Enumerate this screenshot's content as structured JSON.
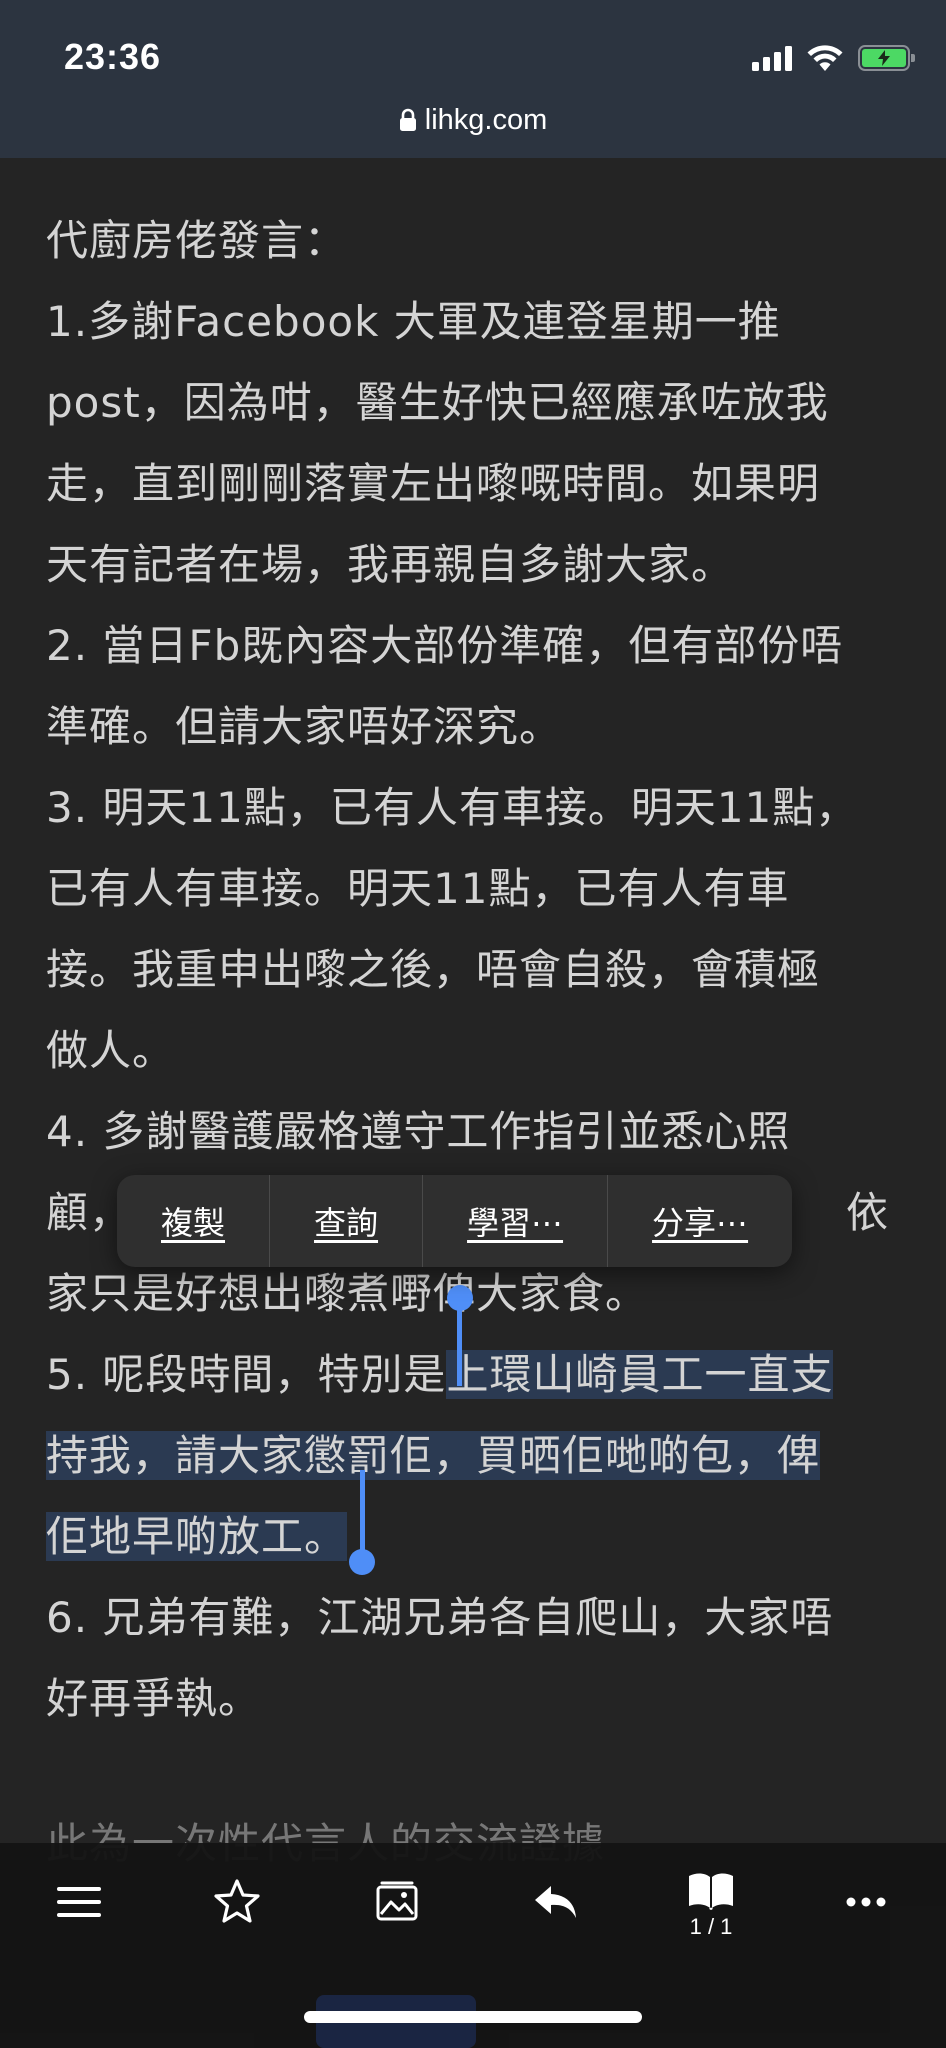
{
  "status_bar": {
    "time": "23:36"
  },
  "browser": {
    "url": "lihkg.com"
  },
  "article": {
    "lines": [
      "代廚房佬發言：",
      "1.多謝Facebook 大軍及連登星期一推",
      "post，因為咁，醫生好快已經應承咗放我",
      "走，直到剛剛落實左出嚟嘅時間。如果明",
      "天有記者在場，我再親自多謝大家。",
      "2. 當日Fb既內容大部份準確，但有部份唔",
      "準確。但請大家唔好深究。",
      "3. 明天11點，已有人有車接。明天11點，",
      "已有人有車接。明天11點，已有人有車",
      "接。我重申出嚟之後，唔會自殺，會積極",
      "做人。",
      "4. 多謝醫護嚴格遵守工作指引並悉心照",
      "顧，",
      "家只是好想出嚟煮嘢俾大家食。",
      "5. 呢段時間，特別是",
      "上環山崎員工一直支",
      "持我，請大家懲罰佢，買晒佢哋啲包，俾",
      "佢地早啲放工。",
      "6. 兄弟有難，江湖兄弟各自爬山，大家唔",
      "好再爭執。"
    ],
    "line13_tail": "依",
    "cutoff_line": "此為一次性代言人的交流證據"
  },
  "context_menu": {
    "copy": "複製",
    "lookup": "查詢",
    "learn": "學習⋯",
    "share": "分享⋯"
  },
  "toolbar": {
    "tabs_count": "1 / 1"
  },
  "colors": {
    "selection": "#2b3a52",
    "handle": "#4f8ef7",
    "battery": "#4cd964"
  }
}
